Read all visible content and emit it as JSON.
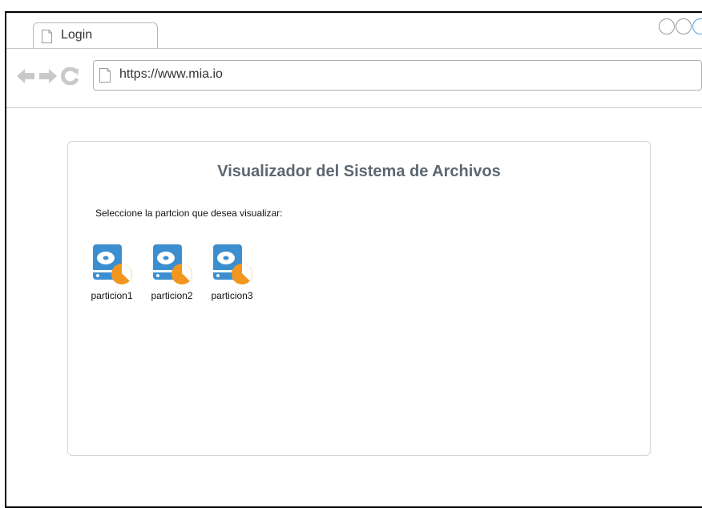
{
  "browser": {
    "tab_title": "Login",
    "url": "https://www.mia.io"
  },
  "page": {
    "title": "Visualizador del Sistema de Archivos",
    "prompt": "Seleccione la partcion que desea visualizar:",
    "partitions": [
      {
        "label": "particion1",
        "icon": "hard-drive-icon"
      },
      {
        "label": "particion2",
        "icon": "hard-drive-icon"
      },
      {
        "label": "particion3",
        "icon": "hard-drive-icon"
      }
    ]
  },
  "colors": {
    "title": "#5d6770",
    "drive_blue": "#3b8fd0",
    "pie_orange": "#f3961f",
    "window_btn_active": "#4aa3e6"
  }
}
